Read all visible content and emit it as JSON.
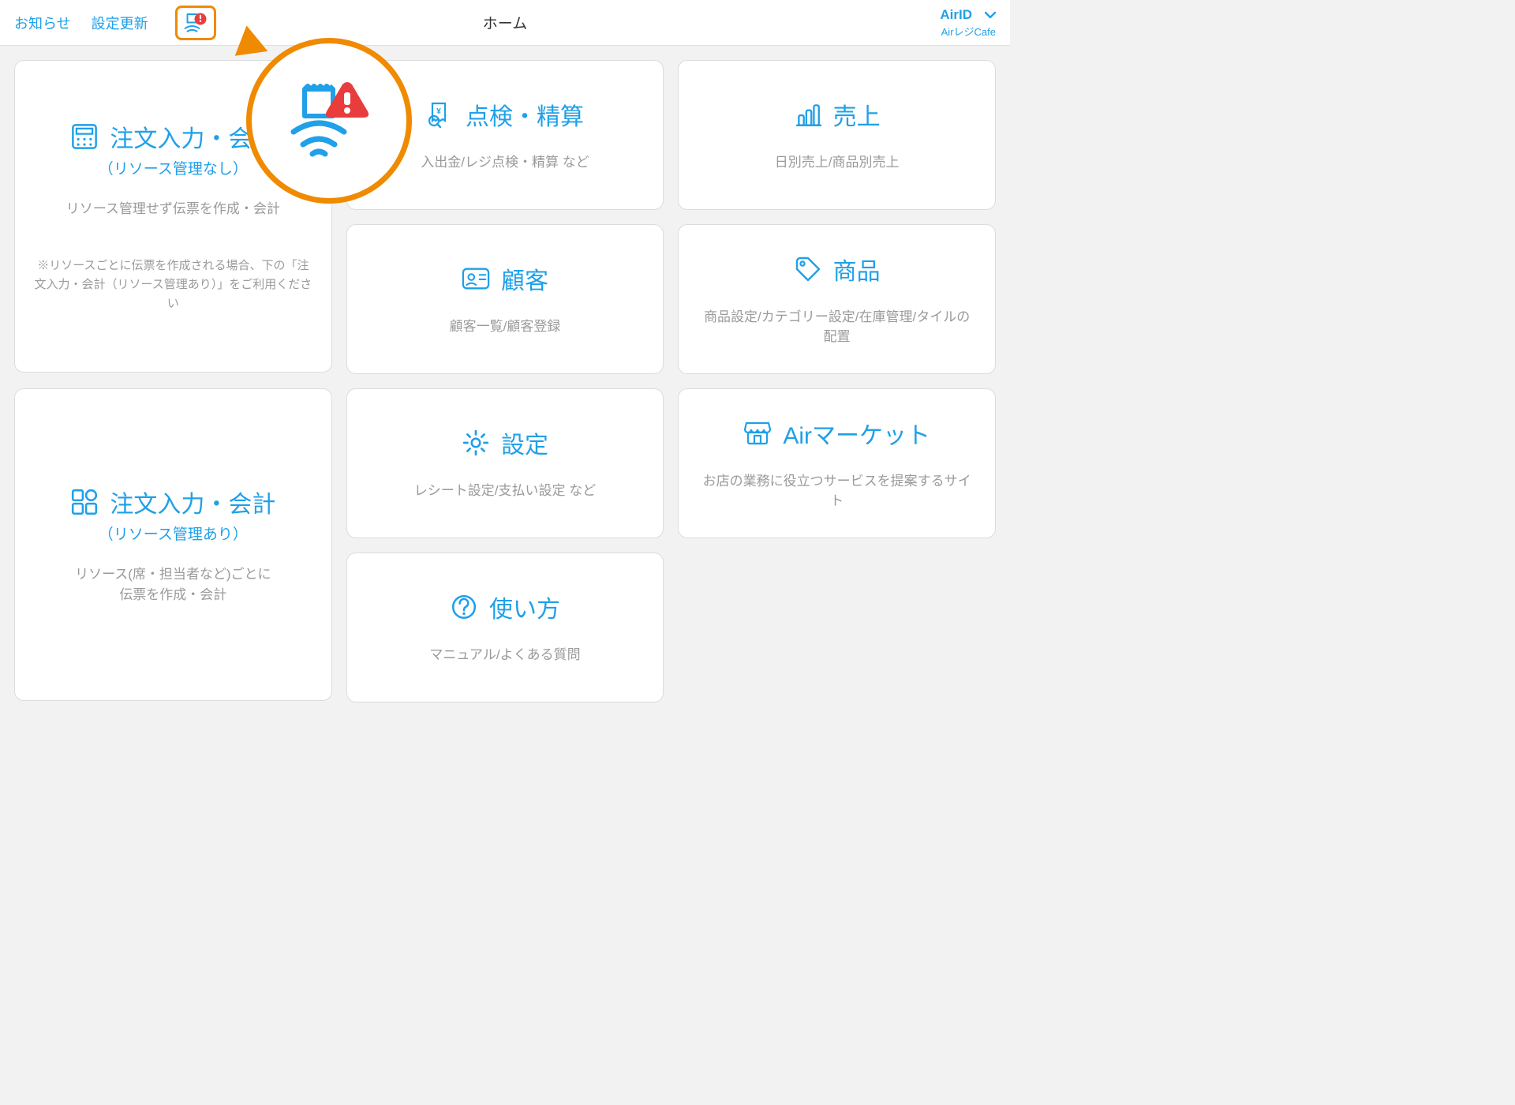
{
  "header": {
    "notice": "お知らせ",
    "settings_update": "設定更新",
    "title": "ホーム",
    "account_id": "AirID",
    "account_sub": "AirレジCafe"
  },
  "tiles": {
    "order_no_resource": {
      "title": "注文入力・会計",
      "sub": "（リソース管理なし）",
      "desc": "リソース管理せず伝票を作成・会計",
      "note": "※リソースごとに伝票を作成される場合、下の「注文入力・会計（リソース管理あり）」をご利用ください"
    },
    "check": {
      "title": "点検・精算",
      "desc": "入出金/レジ点検・精算 など"
    },
    "sales": {
      "title": "売上",
      "desc": "日別売上/商品別売上"
    },
    "customer": {
      "title": "顧客",
      "desc": "顧客一覧/顧客登録"
    },
    "product": {
      "title": "商品",
      "desc": "商品設定/カテゴリー設定/在庫管理/タイルの配置"
    },
    "order_with_resource": {
      "title": "注文入力・会計",
      "sub": "（リソース管理あり）",
      "desc": "リソース(席・担当者など)ごとに\n伝票を作成・会計"
    },
    "settings": {
      "title": "設定",
      "desc": "レシート設定/支払い設定 など"
    },
    "market": {
      "title": "Airマーケット",
      "desc": "お店の業務に役立つサービスを提案するサイト"
    },
    "help": {
      "title": "使い方",
      "desc": "マニュアル/よくある質問"
    }
  },
  "colors": {
    "primary": "#1fa0e8",
    "accent": "#f08a00",
    "alert": "#e93d3d"
  }
}
